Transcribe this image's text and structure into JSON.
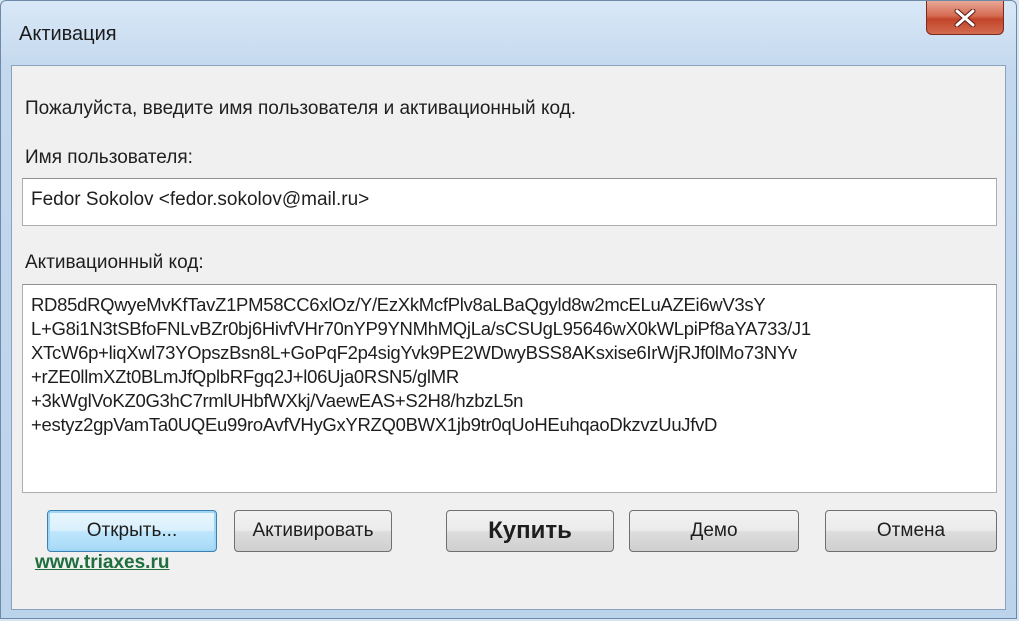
{
  "window": {
    "title": "Активация"
  },
  "dialog": {
    "instruction": "Пожалуйста, введите имя пользователя и активационный код.",
    "username_label": "Имя пользователя:",
    "username_value": "Fedor Sokolov <fedor.sokolov@mail.ru>",
    "code_label": "Активационный код:",
    "code_lines": [
      "RD85dRQwyeMvKfTavZ1PM58CC6xlOz/Y/EzXkMcfPlv8aLBaQgyld8w2mcELuAZEi6wV3sY",
      "L+G8i1N3tSBfoFNLvBZr0bj6HivfVHr70nYP9YNMhMQjLa/sCSUgL95646wX0kWLpiPf8aYA733/J1",
      "XTcW6p+liqXwl73YOpszBsn8L+GoPqF2p4sigYvk9PE2WDwyBSS8AKsxise6IrWjRJf0lMo73NYv",
      "+rZE0llmXZt0BLmJfQplbRFgq2J+l06Uja0RSN5/glMR",
      "+3kWglVoKZ0G3hC7rmlUHbfWXkj/VaewEAS+S2H8/hzbzL5n",
      "+estyz2gpVamTa0UQEu99roAvfVHyGxYRZQ0BWX1jb9tr0qUoHEuhqaoDkzvzUuJfvD"
    ]
  },
  "buttons": {
    "open": "Открыть...",
    "activate": "Активировать",
    "buy": "Купить",
    "demo": "Демо",
    "cancel": "Отмена"
  },
  "footer": {
    "link": "www.triaxes.ru"
  },
  "colors": {
    "link": "#1f6e3e",
    "close_button": "#c2452a",
    "focus_border": "#3c7fb1"
  }
}
